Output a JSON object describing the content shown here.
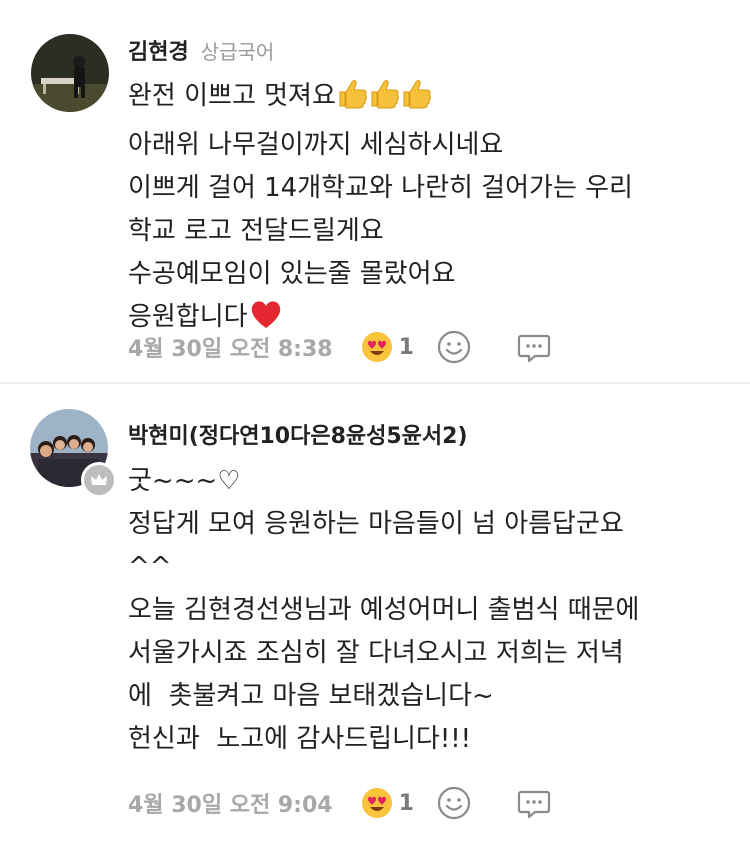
{
  "comments": [
    {
      "author": "김현경",
      "tag": "상급국어",
      "lines": [
        "완전 이쁘고 멋져요",
        "아래위 나무걸이까지 세심하시네요",
        "이쁘게 걸어 14개학교와 나란히 걸어가는 우리",
        "학교 로고 전달드릴게요",
        "수공예모임이 있는줄 몰랐어요",
        "응원합니다"
      ],
      "timestamp": "4월 30일 오전 8:38",
      "reaction_count": "1",
      "icons": {
        "reaction": "heart-eyes-emoji",
        "react_button": "smiley-icon",
        "reply": "comment-icon",
        "inline": [
          "thumbs-up-emoji",
          "heart-emoji"
        ]
      }
    },
    {
      "author": "박현미(정다연10다은8윤성5윤서2)",
      "lines": [
        "굿~~~♡",
        "정답게 모여 응원하는 마음들이 넘 아름답군요",
        "^^",
        "오늘 김현경선생님과 예성어머니 출범식 때문에",
        "서울가시죠 조심히 잘 다녀오시고 저희는 저녁",
        "에  촛불켜고 마음 보태겠습니다~",
        "헌신과  노고에 감사드립니다!!!"
      ],
      "timestamp": "4월 30일 오전 9:04",
      "reaction_count": "1",
      "icons": {
        "reaction": "heart-eyes-emoji",
        "react_button": "smiley-icon",
        "reply": "comment-icon",
        "badge": "crown-icon"
      }
    }
  ],
  "colors": {
    "text": "#222222",
    "muted": "#a8a8a8",
    "tag": "#9a9a9a",
    "divider": "#ececec"
  }
}
